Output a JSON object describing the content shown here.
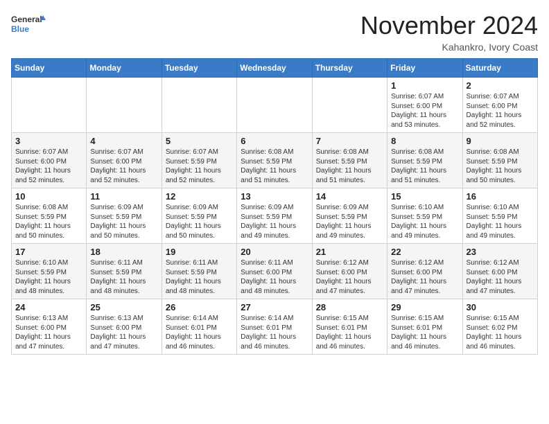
{
  "logo": {
    "general": "General",
    "blue": "Blue"
  },
  "title": "November 2024",
  "location": "Kahankro, Ivory Coast",
  "days_of_week": [
    "Sunday",
    "Monday",
    "Tuesday",
    "Wednesday",
    "Thursday",
    "Friday",
    "Saturday"
  ],
  "weeks": [
    [
      {
        "day": "",
        "info": ""
      },
      {
        "day": "",
        "info": ""
      },
      {
        "day": "",
        "info": ""
      },
      {
        "day": "",
        "info": ""
      },
      {
        "day": "",
        "info": ""
      },
      {
        "day": "1",
        "info": "Sunrise: 6:07 AM\nSunset: 6:00 PM\nDaylight: 11 hours and 53 minutes."
      },
      {
        "day": "2",
        "info": "Sunrise: 6:07 AM\nSunset: 6:00 PM\nDaylight: 11 hours and 52 minutes."
      }
    ],
    [
      {
        "day": "3",
        "info": "Sunrise: 6:07 AM\nSunset: 6:00 PM\nDaylight: 11 hours and 52 minutes."
      },
      {
        "day": "4",
        "info": "Sunrise: 6:07 AM\nSunset: 6:00 PM\nDaylight: 11 hours and 52 minutes."
      },
      {
        "day": "5",
        "info": "Sunrise: 6:07 AM\nSunset: 5:59 PM\nDaylight: 11 hours and 52 minutes."
      },
      {
        "day": "6",
        "info": "Sunrise: 6:08 AM\nSunset: 5:59 PM\nDaylight: 11 hours and 51 minutes."
      },
      {
        "day": "7",
        "info": "Sunrise: 6:08 AM\nSunset: 5:59 PM\nDaylight: 11 hours and 51 minutes."
      },
      {
        "day": "8",
        "info": "Sunrise: 6:08 AM\nSunset: 5:59 PM\nDaylight: 11 hours and 51 minutes."
      },
      {
        "day": "9",
        "info": "Sunrise: 6:08 AM\nSunset: 5:59 PM\nDaylight: 11 hours and 50 minutes."
      }
    ],
    [
      {
        "day": "10",
        "info": "Sunrise: 6:08 AM\nSunset: 5:59 PM\nDaylight: 11 hours and 50 minutes."
      },
      {
        "day": "11",
        "info": "Sunrise: 6:09 AM\nSunset: 5:59 PM\nDaylight: 11 hours and 50 minutes."
      },
      {
        "day": "12",
        "info": "Sunrise: 6:09 AM\nSunset: 5:59 PM\nDaylight: 11 hours and 50 minutes."
      },
      {
        "day": "13",
        "info": "Sunrise: 6:09 AM\nSunset: 5:59 PM\nDaylight: 11 hours and 49 minutes."
      },
      {
        "day": "14",
        "info": "Sunrise: 6:09 AM\nSunset: 5:59 PM\nDaylight: 11 hours and 49 minutes."
      },
      {
        "day": "15",
        "info": "Sunrise: 6:10 AM\nSunset: 5:59 PM\nDaylight: 11 hours and 49 minutes."
      },
      {
        "day": "16",
        "info": "Sunrise: 6:10 AM\nSunset: 5:59 PM\nDaylight: 11 hours and 49 minutes."
      }
    ],
    [
      {
        "day": "17",
        "info": "Sunrise: 6:10 AM\nSunset: 5:59 PM\nDaylight: 11 hours and 48 minutes."
      },
      {
        "day": "18",
        "info": "Sunrise: 6:11 AM\nSunset: 5:59 PM\nDaylight: 11 hours and 48 minutes."
      },
      {
        "day": "19",
        "info": "Sunrise: 6:11 AM\nSunset: 5:59 PM\nDaylight: 11 hours and 48 minutes."
      },
      {
        "day": "20",
        "info": "Sunrise: 6:11 AM\nSunset: 6:00 PM\nDaylight: 11 hours and 48 minutes."
      },
      {
        "day": "21",
        "info": "Sunrise: 6:12 AM\nSunset: 6:00 PM\nDaylight: 11 hours and 47 minutes."
      },
      {
        "day": "22",
        "info": "Sunrise: 6:12 AM\nSunset: 6:00 PM\nDaylight: 11 hours and 47 minutes."
      },
      {
        "day": "23",
        "info": "Sunrise: 6:12 AM\nSunset: 6:00 PM\nDaylight: 11 hours and 47 minutes."
      }
    ],
    [
      {
        "day": "24",
        "info": "Sunrise: 6:13 AM\nSunset: 6:00 PM\nDaylight: 11 hours and 47 minutes."
      },
      {
        "day": "25",
        "info": "Sunrise: 6:13 AM\nSunset: 6:00 PM\nDaylight: 11 hours and 47 minutes."
      },
      {
        "day": "26",
        "info": "Sunrise: 6:14 AM\nSunset: 6:01 PM\nDaylight: 11 hours and 46 minutes."
      },
      {
        "day": "27",
        "info": "Sunrise: 6:14 AM\nSunset: 6:01 PM\nDaylight: 11 hours and 46 minutes."
      },
      {
        "day": "28",
        "info": "Sunrise: 6:15 AM\nSunset: 6:01 PM\nDaylight: 11 hours and 46 minutes."
      },
      {
        "day": "29",
        "info": "Sunrise: 6:15 AM\nSunset: 6:01 PM\nDaylight: 11 hours and 46 minutes."
      },
      {
        "day": "30",
        "info": "Sunrise: 6:15 AM\nSunset: 6:02 PM\nDaylight: 11 hours and 46 minutes."
      }
    ]
  ]
}
